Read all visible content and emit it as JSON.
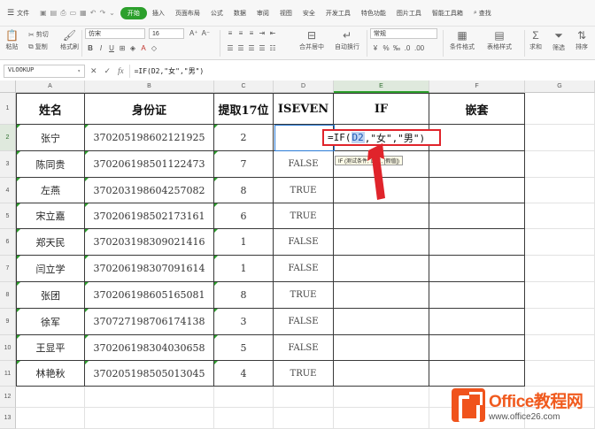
{
  "menu": {
    "file": "文件",
    "tabs": [
      "开始",
      "插入",
      "页面布局",
      "公式",
      "数据",
      "审阅",
      "视图",
      "安全",
      "开发工具",
      "特色功能",
      "图片工具",
      "智能工具箱"
    ],
    "search": "查找"
  },
  "ribbon": {
    "paste": "粘贴",
    "cut": "剪切",
    "copy": "复制",
    "format_painter": "格式刷",
    "font_name": "仿宋",
    "font_size": "16",
    "merge": "合并居中",
    "wrap": "自动换行",
    "number_format": "常规",
    "cond_format": "条件格式",
    "table_style": "表格样式",
    "sum": "求和",
    "filter": "筛选",
    "sort": "排序"
  },
  "formula_bar": {
    "name_box": "VLOOKUP",
    "fx": "fx",
    "formula": "=IF(D2,\"女\",\"男\")"
  },
  "columns": [
    "A",
    "B",
    "C",
    "D",
    "E",
    "F",
    "G"
  ],
  "rows": [
    "1",
    "2",
    "3",
    "4",
    "5",
    "6",
    "7",
    "8",
    "9",
    "10",
    "11",
    "12",
    "13"
  ],
  "table": {
    "headers": [
      "姓名",
      "身份证",
      "提取17位",
      "ISEVEN",
      "IF",
      "嵌套"
    ],
    "data": [
      [
        "张宁",
        "370205198602121925",
        "2",
        ""
      ],
      [
        "陈同贵",
        "370206198501122473",
        "7",
        "FALSE"
      ],
      [
        "左燕",
        "370203198604257082",
        "8",
        "TRUE"
      ],
      [
        "宋立嘉",
        "370206198502173161",
        "6",
        "TRUE"
      ],
      [
        "郑天民",
        "370203198309021416",
        "1",
        "FALSE"
      ],
      [
        "闫立学",
        "370206198307091614",
        "1",
        "FALSE"
      ],
      [
        "张团",
        "370206198605165081",
        "8",
        "TRUE"
      ],
      [
        "徐军",
        "370727198706174138",
        "3",
        "FALSE"
      ],
      [
        "王显平",
        "370206198304030658",
        "5",
        "FALSE"
      ],
      [
        "林艳秋",
        "370205198505013045",
        "4",
        "TRUE"
      ]
    ]
  },
  "editor": {
    "prefix": "=IF(",
    "ref": "D2",
    "suffix": ",\"女\",\"男\")"
  },
  "tooltip": "IF (测试条件, 真值, [假值])",
  "watermark": {
    "title": "Office教程网",
    "url": "www.office26.com"
  },
  "colors": {
    "accent_green": "#2ca02c",
    "highlight_red": "#e0242b",
    "watermark_orange": "#f05a1e"
  }
}
